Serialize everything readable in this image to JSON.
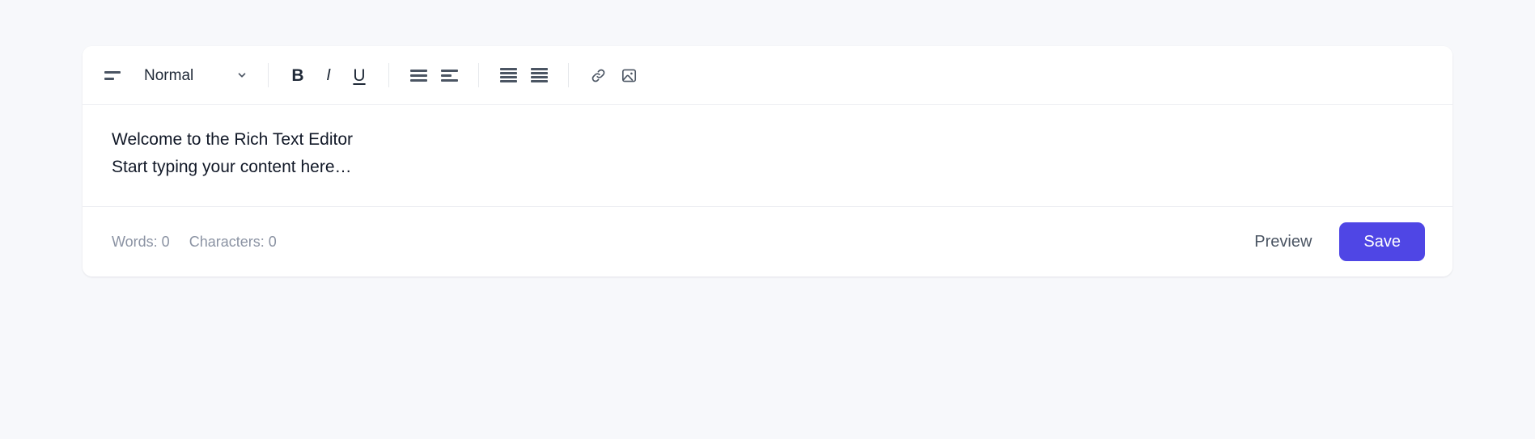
{
  "theme": {
    "page_background": "#f7f8fb",
    "card_background": "#ffffff",
    "accent": "#4f46e5",
    "icon_color": "#4b5563",
    "muted_text": "#8b93a3",
    "body_text": "#111827",
    "border": "#eceef2"
  },
  "toolbar": {
    "paragraph_style_icon": "paragraph-lines-icon",
    "style_select": {
      "value": "Normal",
      "chevron_icon": "chevron-down-icon",
      "options": [
        "Normal"
      ]
    },
    "bold": {
      "label": "B",
      "icon": "bold-icon"
    },
    "italic": {
      "label": "I",
      "icon": "italic-icon"
    },
    "underline": {
      "label": "U",
      "icon": "underline-icon"
    },
    "bullet_list_icon": "bullet-list-icon",
    "ordered_list_icon": "align-left-list-icon",
    "align_justify_icon": "align-justify-icon",
    "align_justify_alt_icon": "align-justify-alt-icon",
    "link_icon": "link-icon",
    "image_icon": "image-icon"
  },
  "content": {
    "heading_line": "Welcome to the Rich Text Editor",
    "placeholder_line": "Start typing your content here…"
  },
  "footer": {
    "words_label": "Words: 0",
    "characters_label": "Characters: 0",
    "preview_label": "Preview",
    "save_label": "Save"
  }
}
